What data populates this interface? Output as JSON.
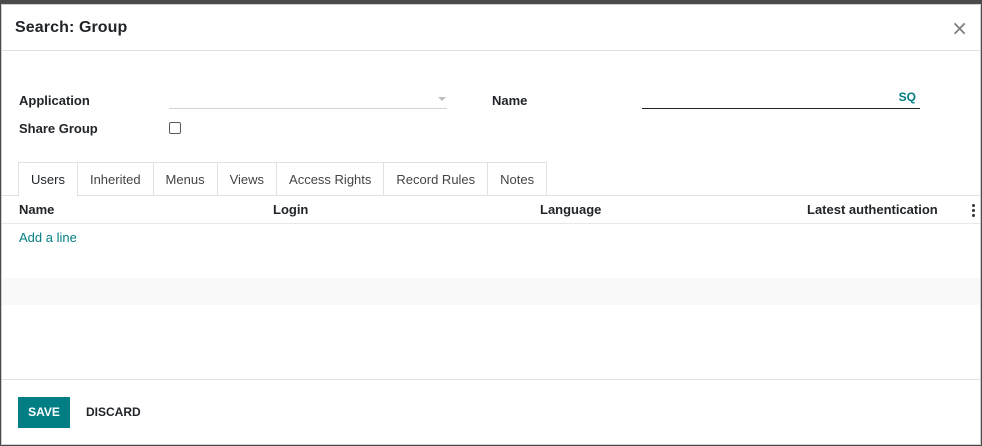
{
  "dialog": {
    "title": "Search: Group",
    "close_label": "×"
  },
  "form": {
    "application_label": "Application",
    "application_value": "",
    "name_label": "Name",
    "name_value": "",
    "name_suffix": "SQ",
    "share_group_label": "Share Group",
    "share_group_checked": false
  },
  "tabs": [
    {
      "label": "Users",
      "active": true
    },
    {
      "label": "Inherited",
      "active": false
    },
    {
      "label": "Menus",
      "active": false
    },
    {
      "label": "Views",
      "active": false
    },
    {
      "label": "Access Rights",
      "active": false
    },
    {
      "label": "Record Rules",
      "active": false
    },
    {
      "label": "Notes",
      "active": false
    }
  ],
  "table": {
    "columns": [
      "Name",
      "Login",
      "Language",
      "Latest authentication"
    ],
    "add_line_label": "Add a line"
  },
  "footer": {
    "save_label": "SAVE",
    "discard_label": "DISCARD"
  },
  "colors": {
    "accent": "#017e84"
  }
}
